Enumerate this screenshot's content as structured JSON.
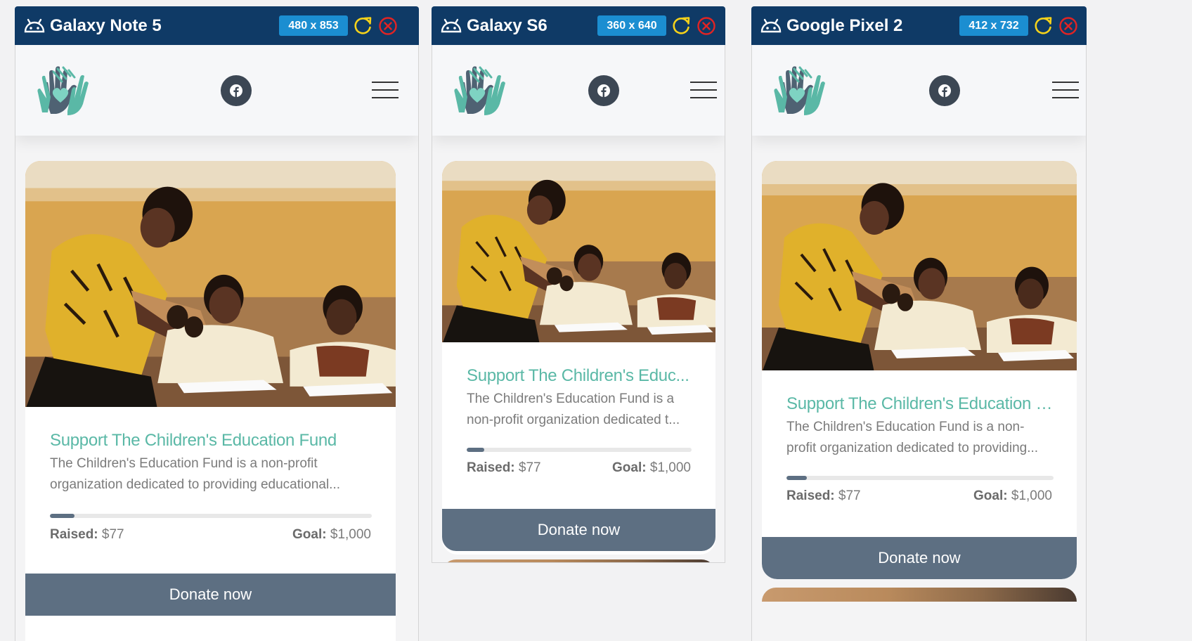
{
  "devices": [
    {
      "name": "Galaxy Note 5",
      "resolution": "480 x 853"
    },
    {
      "name": "Galaxy S6",
      "resolution": "360 x 640"
    },
    {
      "name": "Google Pixel 2",
      "resolution": "412 x 732"
    }
  ],
  "campaign": {
    "title": "Support The Children's Education Fund",
    "title_short_s6": "Support The Children's Educ...",
    "title_short_pixel": "Support The Children's Education F...",
    "desc_line1_wide": "The Children's Education Fund is a non-profit",
    "desc_line2_wide": "organization dedicated to providing educational...",
    "desc_line1_s6": "The Children's Education Fund is a",
    "desc_line2_s6": "non-profit organization dedicated t...",
    "desc_line1_pixel": "The Children's Education Fund is a non-",
    "desc_line2_pixel": "profit organization dedicated to providing...",
    "raised_label": "Raised:",
    "raised_value": "$77",
    "goal_label": "Goal:",
    "goal_value": "$1,000",
    "progress_fraction": 0.077,
    "donate_label": "Donate now"
  },
  "icons": {
    "android": "android-icon",
    "reload": "reload-icon",
    "close": "close-icon",
    "facebook": "facebook-icon",
    "menu": "menu-icon",
    "logo": "hands-heart-logo"
  },
  "colors": {
    "titlebar": "#0f3a66",
    "resolution_badge": "#1b8ed1",
    "reload": "#f5d21a",
    "close": "#e02424",
    "title_teal": "#5ab8a6",
    "button": "#5d6f82"
  }
}
